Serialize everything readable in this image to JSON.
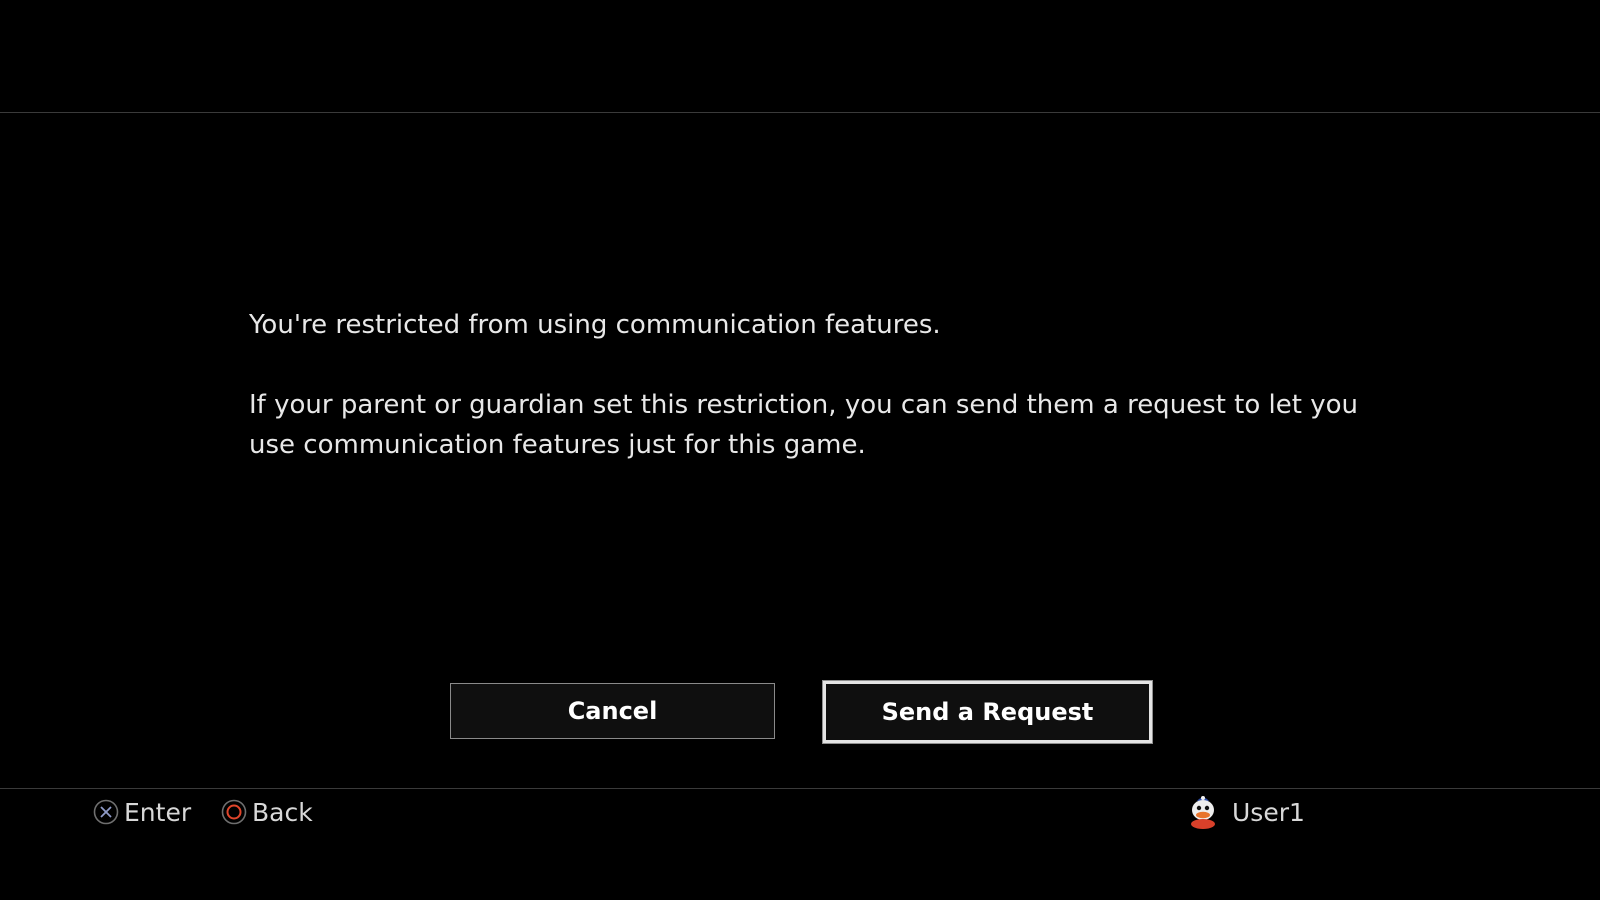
{
  "dialog": {
    "line1": "You're restricted from using communication features.",
    "line2": "If your parent or guardian set this restriction, you can send them a request to let you use communication features just for this game."
  },
  "buttons": {
    "cancel_label": "Cancel",
    "send_label": "Send a Request",
    "focused": "send"
  },
  "footer": {
    "enter_icon": "cross-button-icon",
    "enter_label": "Enter",
    "back_icon": "circle-button-icon",
    "back_label": "Back",
    "user_avatar": "penguin-avatar-icon",
    "user_name": "User1"
  },
  "colors": {
    "background": "#000000",
    "text": "#e8e8e8",
    "cross_icon": "#8f9bc8",
    "circle_icon": "#e0452b",
    "focus_border": "#e4e4e4"
  }
}
